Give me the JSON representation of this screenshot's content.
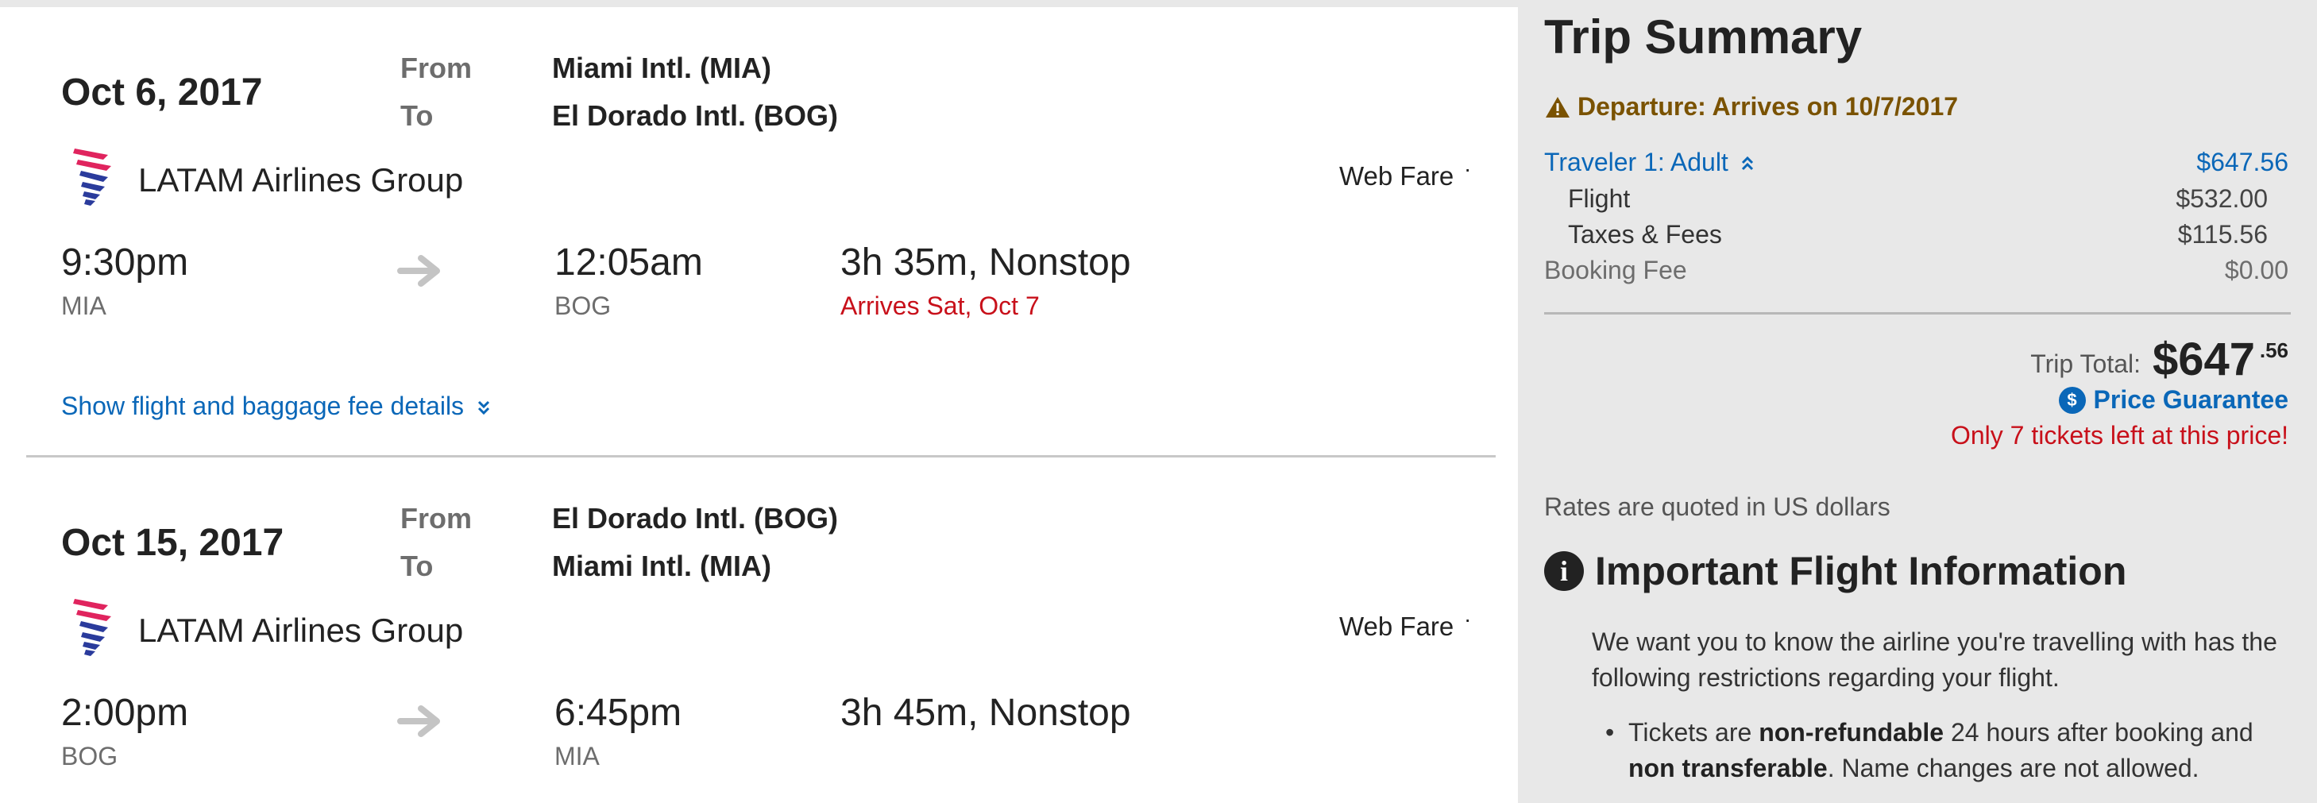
{
  "legs": [
    {
      "date": "Oct 6, 2017",
      "from_label": "From",
      "to_label": "To",
      "from_airport": "Miami Intl. (MIA)",
      "to_airport": "El Dorado Intl. (BOG)",
      "airline": "LATAM Airlines Group",
      "fare": "Web Fare",
      "fare_dot": "·",
      "depart_time": "9:30pm",
      "depart_code": "MIA",
      "arrive_time": "12:05am",
      "arrive_code": "BOG",
      "duration": "3h 35m, Nonstop",
      "arrives_note": "Arrives Sat, Oct 7",
      "details_link": "Show flight and baggage fee details"
    },
    {
      "date": "Oct 15, 2017",
      "from_label": "From",
      "to_label": "To",
      "from_airport": "El Dorado Intl. (BOG)",
      "to_airport": "Miami Intl. (MIA)",
      "airline": "LATAM Airlines Group",
      "fare": "Web Fare",
      "fare_dot": "·",
      "depart_time": "2:00pm",
      "depart_code": "BOG",
      "arrive_time": "6:45pm",
      "arrive_code": "MIA",
      "duration": "3h 45m, Nonstop"
    }
  ],
  "summary": {
    "title": "Trip Summary",
    "departure_warning": "Departure: Arrives on 10/7/2017",
    "traveler_label": "Traveler 1: Adult",
    "traveler_amount": "$647.56",
    "flight_label": "Flight",
    "flight_amount": "$532.00",
    "taxes_label": "Taxes & Fees",
    "taxes_amount": "$115.56",
    "booking_label": "Booking Fee",
    "booking_amount": "$0.00",
    "trip_total_label": "Trip Total:",
    "trip_total_dollars": "$647",
    "trip_total_cents": ".56",
    "guarantee_icon": "$",
    "price_guarantee": "Price Guarantee",
    "tickets_left": "Only 7 tickets left at this price!",
    "rates_note": "Rates are quoted in US dollars"
  },
  "important": {
    "icon": "i",
    "heading": "Important Flight Information",
    "intro": "We want you to know the airline you're travelling with has the following restrictions regarding your flight.",
    "bullet_prefix": "Tickets are ",
    "bullet_bold1": "non-refundable",
    "bullet_mid": " 24 hours after booking and ",
    "bullet_bold2": "non transferable",
    "bullet_suffix": ". Name changes are not allowed."
  },
  "colors": {
    "link_blue": "#0a67b8",
    "alert_red": "#c8101a",
    "warning_brown": "#7a5200",
    "panel_gray": "#e8e8e8"
  },
  "icons": {
    "airline_logo": "latam-logo-icon",
    "arrow": "right-arrow-icon",
    "chevron": "double-chevron-down-icon",
    "warning": "warning-triangle-icon",
    "traveler_chevron": "double-chevron-up-icon",
    "guarantee": "dollar-circle-icon",
    "info": "info-circle-icon"
  }
}
